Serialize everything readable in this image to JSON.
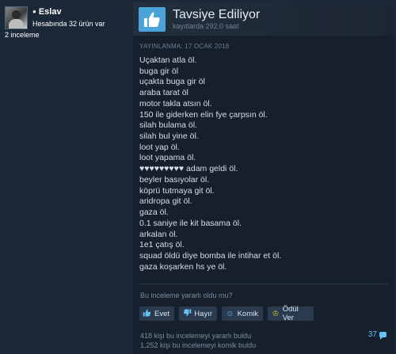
{
  "author": {
    "status_dot": "●",
    "name": "Eslav",
    "games": "Hesabında 32 ürün var",
    "reviews": "2 inceleme"
  },
  "review": {
    "verdict": "Tavsiye Ediliyor",
    "hours": "kayıtlarda 292.0 saat",
    "posted": "YAYINLANMA: 17 OCAK 2018",
    "lines": [
      "Uçaktan atla öl.",
      "buga gir öl",
      "uçakta buga gir öl",
      "araba tarat öl",
      "motor takla atsın öl.",
      "150 ile giderken elin fye çarpsın öl.",
      "silah bulama öl.",
      "silah bul yine öl.",
      "loot yap öl.",
      "loot yapama öl.",
      "♥♥♥♥♥♥♥♥♥ adam geldi öl.",
      "beyler basıyolar öl.",
      "köprü tutmaya git öl.",
      "aridropa git öl.",
      "gaza öl.",
      "0.1 saniye ile kit basama öl.",
      "arkalan öl.",
      "1e1 çatış öl.",
      "squad öldü diye bomba ile intihar et öl.",
      "gaza koşarken hs ye öl."
    ],
    "helpful_question": "Bu inceleme yararlı oldu mu?",
    "buttons": {
      "yes": "Evet",
      "no": "Hayır",
      "funny": "Komik",
      "award": "Ödül Ver"
    },
    "helpful_count": "418 kişi bu incelemeyi yararlı buldu",
    "funny_count": "1,252 kişi bu incelemeyi komik buldu",
    "comments": "37"
  },
  "colors": {
    "background": "#1b2838",
    "panel": "#16202d",
    "accent": "#67c1f5",
    "thumb_bg": "#4aa3d9"
  },
  "icons": {
    "thumb": "thumbs-up-icon",
    "yes": "thumbs-up-icon",
    "no": "thumbs-down-icon",
    "funny": "smiley-icon",
    "award": "award-icon",
    "comments": "comment-bubble-icon"
  }
}
